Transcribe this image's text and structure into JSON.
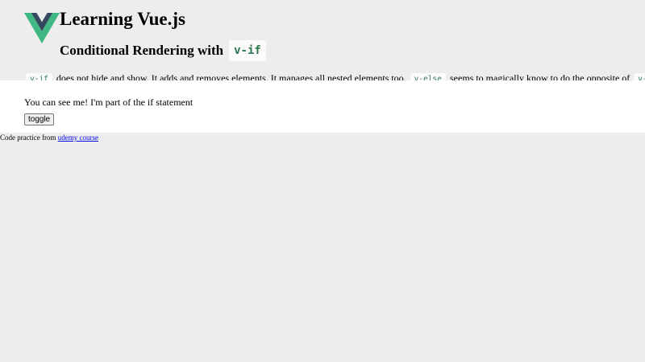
{
  "header": {
    "title": "Learning Vue.js",
    "subtitle_text": "Conditional Rendering with",
    "subtitle_code": "v-if"
  },
  "description": {
    "code1": "v-if",
    "text1": "does not hide and show. It adds and removes elements. It manages all nested elements too.",
    "code2": "v-else",
    "text2": "seems to magically know to do the opposite of",
    "code3": "v-if"
  },
  "content": {
    "message": "You can see me! I'm part of the if statement",
    "toggle_label": "toggle"
  },
  "footer": {
    "prefix": "Code practice from",
    "link_text": "udemy course"
  },
  "colors": {
    "vue_green": "#41b883",
    "vue_dark": "#34495e",
    "code_text": "#2f7a52"
  }
}
